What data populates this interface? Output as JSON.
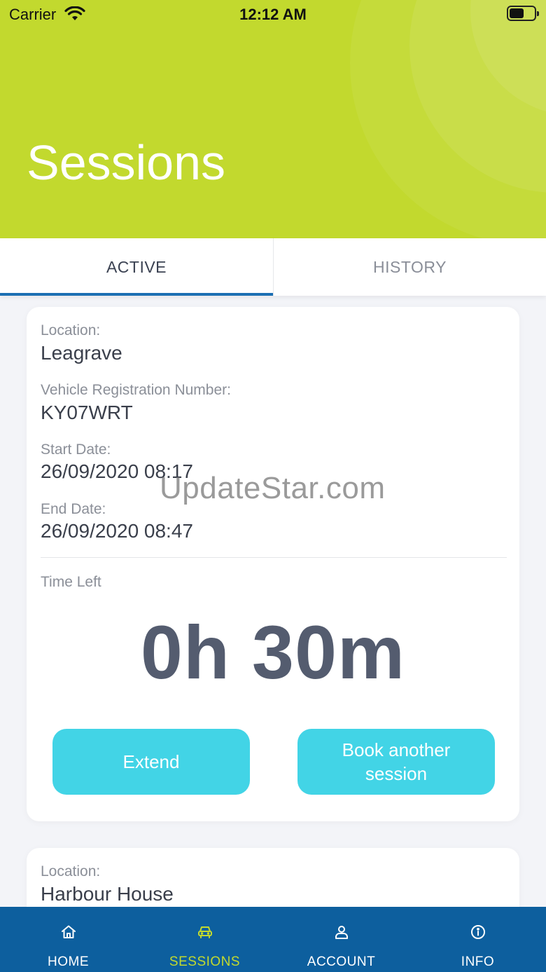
{
  "status_bar": {
    "carrier": "Carrier",
    "time": "12:12 AM"
  },
  "header": {
    "title": "Sessions",
    "color": "#c2d92e"
  },
  "tabs": [
    {
      "label": "ACTIVE",
      "active": true
    },
    {
      "label": "HISTORY",
      "active": false
    }
  ],
  "sessions": [
    {
      "location_label": "Location:",
      "location": "Leagrave",
      "vrn_label": "Vehicle Registration Number:",
      "vrn": "KY07WRT",
      "start_label": "Start Date:",
      "start": "26/09/2020 08:17",
      "end_label": "End Date:",
      "end": "26/09/2020 08:47",
      "time_left_label": "Time Left",
      "time_left": "0h 30m",
      "extend_label": "Extend",
      "book_label": "Book another session"
    },
    {
      "location_label": "Location:",
      "location": "Harbour House"
    }
  ],
  "watermark": "UpdateStar.com",
  "nav": {
    "items": [
      {
        "label": "HOME",
        "icon": "home-icon",
        "active": false
      },
      {
        "label": "SESSIONS",
        "icon": "car-icon",
        "active": true
      },
      {
        "label": "ACCOUNT",
        "icon": "user-icon",
        "active": false
      },
      {
        "label": "INFO",
        "icon": "info-icon",
        "active": false
      }
    ],
    "background": "#0d5f9e",
    "active_color": "#c2d92e",
    "inactive_color": "#ffffff"
  },
  "colors": {
    "accent_button": "#42d4e6",
    "tab_indicator": "#1c6fb3"
  }
}
